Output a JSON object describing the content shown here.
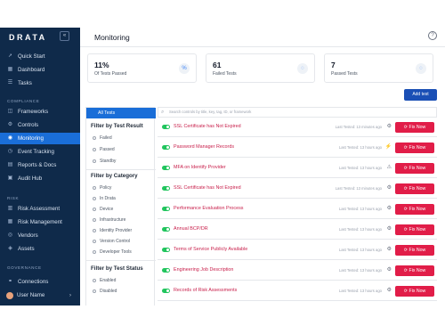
{
  "sidebar": {
    "brand": "DRATA",
    "collapse_icon": "«",
    "items_top": [
      {
        "label": "Quick Start",
        "icon": "rocket-icon",
        "glyph": "➚"
      },
      {
        "label": "Dashboard",
        "icon": "dashboard-icon",
        "glyph": "▦"
      },
      {
        "label": "Tasks",
        "icon": "tasks-icon",
        "glyph": "☰"
      }
    ],
    "compliance_label": "COMPLIANCE",
    "items_compliance": [
      {
        "label": "Frameworks",
        "icon": "frameworks-icon",
        "glyph": "◫"
      },
      {
        "label": "Controls",
        "icon": "controls-icon",
        "glyph": "⚙"
      },
      {
        "label": "Monitoring",
        "icon": "monitoring-icon",
        "glyph": "◉"
      },
      {
        "label": "Event Tracking",
        "icon": "event-tracking-icon",
        "glyph": "◷"
      },
      {
        "label": "Reports & Docs",
        "icon": "reports-icon",
        "glyph": "▤"
      },
      {
        "label": "Audit Hub",
        "icon": "audit-hub-icon",
        "glyph": "▣"
      }
    ],
    "risk_label": "RISK",
    "items_risk": [
      {
        "label": "Risk Assessment",
        "icon": "risk-assessment-icon",
        "glyph": "▥"
      },
      {
        "label": "Risk Management",
        "icon": "risk-management-icon",
        "glyph": "▦"
      },
      {
        "label": "Vendors",
        "icon": "vendors-icon",
        "glyph": "◎"
      },
      {
        "label": "Assets",
        "icon": "assets-icon",
        "glyph": "◈"
      }
    ],
    "governance_label": "GOVERNANCE",
    "items_governance": [
      {
        "label": "Connections",
        "icon": "connections-icon",
        "glyph": "⚭"
      }
    ],
    "user_name": "User Name",
    "user_chevron": "›"
  },
  "header": {
    "title": "Monitoring",
    "help_glyph": "?"
  },
  "stats": [
    {
      "value": "11%",
      "label": "Of Tests Passed",
      "icon": "percent-icon",
      "glyph": "%"
    },
    {
      "value": "61",
      "label": "Failed Tests",
      "icon": "failed-icon",
      "glyph": "◌"
    },
    {
      "value": "7",
      "label": "Passed Tests",
      "icon": "passed-icon",
      "glyph": "◌"
    }
  ],
  "add_test_label": "Add test",
  "filters": {
    "all_tests": "All Tests",
    "result_heading": "Filter by Test Result",
    "result_options": [
      "Failed",
      "Passed",
      "Standby"
    ],
    "category_heading": "Filter by Category",
    "category_options": [
      "Policy",
      "In Drata",
      "Device",
      "Infrastructure",
      "Identity Provider",
      "Version Control",
      "Developer Tools"
    ],
    "status_heading": "Filter by Test Status",
    "status_options": [
      "Enabled",
      "Disabled"
    ]
  },
  "search": {
    "placeholder": "Search controls by title, key, tag, ID, or framework"
  },
  "tests": [
    {
      "name": "SSL Certificate has Not Expired",
      "time": "Last Tested: 13 minutes ago",
      "icon": "status-icon",
      "glyph": "⚙"
    },
    {
      "name": "Password Manager Records",
      "time": "Last Tested: 13 hours ago",
      "icon": "activity-icon",
      "glyph": "⚡"
    },
    {
      "name": "MFA on Identify Provider",
      "time": "Last Tested: 13 hours ago",
      "icon": "warning-icon",
      "glyph": "⚠"
    },
    {
      "name": "SSL Certificate has Not Expired",
      "time": "Last Tested: 13 minutes ago",
      "icon": "status-icon",
      "glyph": "⚙"
    },
    {
      "name": "Performance Evaluation Process",
      "time": "Last Tested: 13 hours ago",
      "icon": "status-icon",
      "glyph": "⚙"
    },
    {
      "name": "Annual BCP/DR",
      "time": "Last Tested: 13 hours ago",
      "icon": "status-icon",
      "glyph": "⚙"
    },
    {
      "name": "Terms of Service Publicly Available",
      "time": "Last Tested: 13 hours ago",
      "icon": "status-icon",
      "glyph": "⚙"
    },
    {
      "name": "Engineering Job Description",
      "time": "Last Tested: 13 hours ago",
      "icon": "status-icon",
      "glyph": "⚙"
    },
    {
      "name": "Records of Risk Assessments",
      "time": "Last Tested: 13 hours ago",
      "icon": "status-icon",
      "glyph": "⚙"
    }
  ],
  "fix_now_label": "Fix Now",
  "fix_now_glyph": "⟳",
  "colors": {
    "sidebar_bg": "#0f2a4a",
    "accent": "#1a6ed8",
    "fix_button": "#e11d48",
    "failed_text": "#c81e4a",
    "toggle_on": "#22c55e"
  }
}
